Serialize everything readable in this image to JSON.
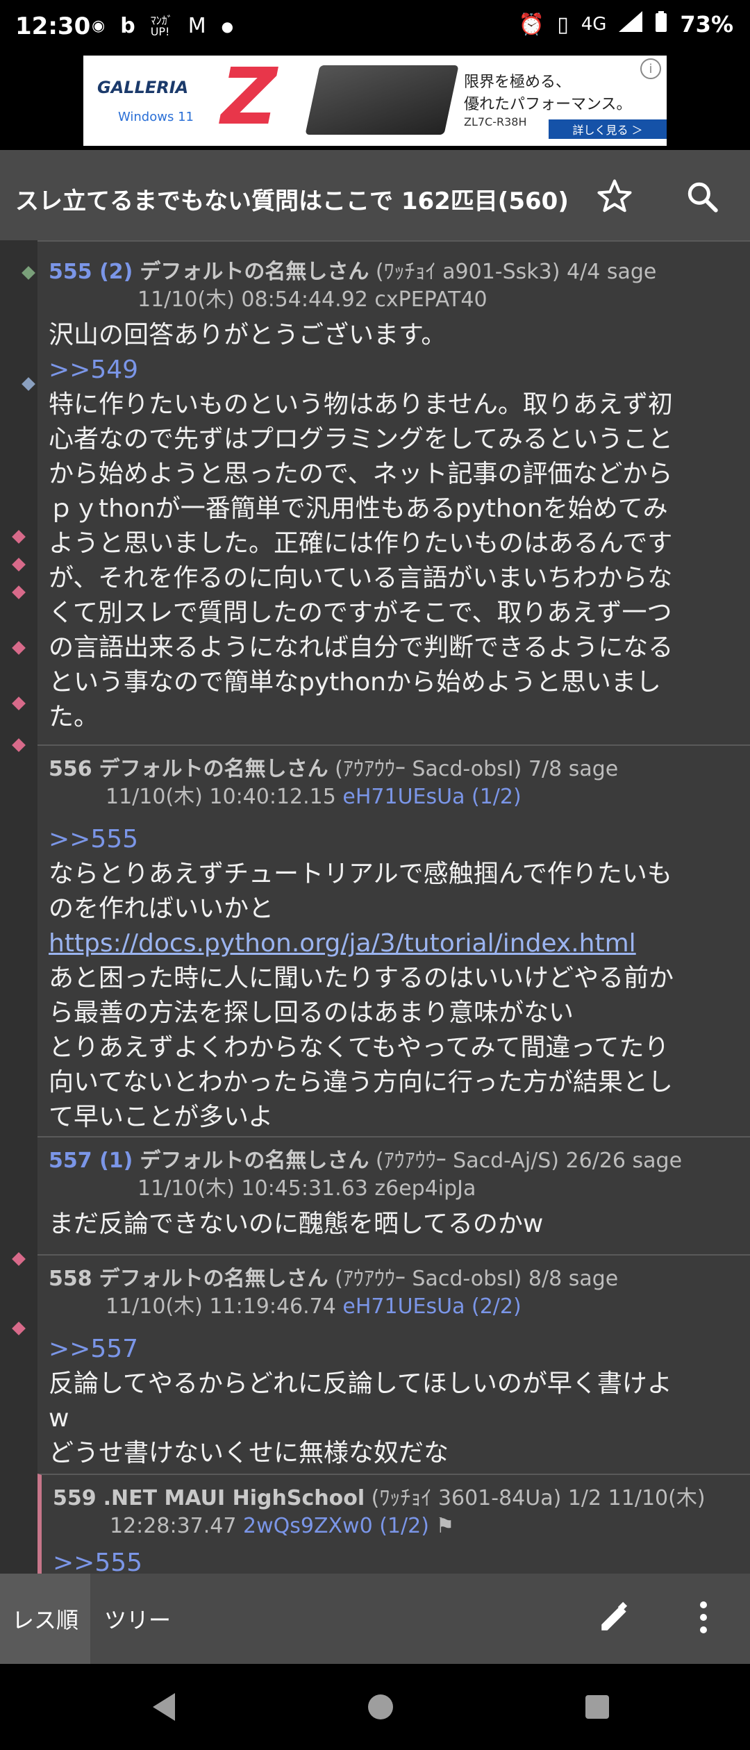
{
  "status": {
    "time": "12:30",
    "network": "4G",
    "battery": "73%",
    "left_icons": [
      "hups-icon",
      "bing-icon",
      "manga-up-icon",
      "gmail-icon",
      "dot-icon"
    ]
  },
  "ad": {
    "brand": "GALLERIA",
    "os": "Windows 11",
    "letter": "Z",
    "line1": "限界を極める、",
    "line2": "優れたパフォーマンス。",
    "model": "ZL7C-R38H",
    "cta": "詳しく見る ＞",
    "info": "i"
  },
  "appbar": {
    "title": "スレ立てるまでもない質問はここで 162匹目(560)"
  },
  "posts": [
    {
      "no": "555 (2)",
      "name": "デフォルトの名無しさん",
      "meta": "(ﾜｯﾁｮｲ a901-Ssk3) 4/4 sage",
      "date": "11/10(木) 08:54:44.92 cxPEPAT40",
      "id_link": "",
      "lines": [
        "沢山の回答ありがとうございます。",
        ">>549",
        "特に作りたいものという物はありません。取りあえず初",
        "心者なので先ずはプログラミングをしてみるということ",
        "から始めようと思ったので、ネット記事の評価などから",
        "ｐｙthonが一番簡単で汎用性もあるpythonを始めてみ",
        "ようと思いました。正確には作りたいものはあるんです",
        "が、それを作るのに向いている言語がいまいちわからな",
        "くて別スレで質問したのですがそこで、取りあえず一つ",
        "の言語出来るようになれば自分で判断できるようになる",
        "という事なので簡単なpythonから始めようと思いまし",
        "た。"
      ]
    },
    {
      "no": "556",
      "name": "デフォルトの名無しさん",
      "meta": "(ｱｳｱｳｳｰ Sacd-obsI) 7/8 sage",
      "date": "11/10(木) 10:40:12.15",
      "id_link": "eH71UEsUa (1/2)",
      "lines": [
        ">>555",
        "ならとりあえずチュートリアルで感触掴んで作りたいも",
        "のを作ればいいかと",
        "https://docs.python.org/ja/3/tutorial/index.html",
        "あと困った時に人に聞いたりするのはいいけどやる前か",
        "ら最善の方法を探し回るのはあまり意味がない",
        "とりあえずよくわからなくてもやってみて間違ってたり",
        "向いてないとわかったら違う方向に行った方が結果とし",
        "て早いことが多いよ"
      ]
    },
    {
      "no": "557 (1)",
      "name": "デフォルトの名無しさん",
      "meta": "(ｱｳｱｳｳｰ Sacd-Aj/S) 26/26 sage",
      "date": "11/10(木) 10:45:31.63 z6ep4ipJa",
      "id_link": "",
      "lines": [
        "まだ反論できないのに醜態を晒してるのかw"
      ]
    },
    {
      "no": "558",
      "name": "デフォルトの名無しさん",
      "meta": "(ｱｳｱｳｳｰ Sacd-obsI) 8/8 sage",
      "date": "11/10(木) 11:19:46.74",
      "id_link": "eH71UEsUa (2/2)",
      "lines": [
        ">>557",
        "反論してやるからどれに反論してほしいのが早く書けよ",
        "w",
        "どうせ書けないくせに無様な奴だな"
      ]
    },
    {
      "no": "559",
      "name": ".NET MAUI HighSchool",
      "meta": "(ﾜｯﾁｮｲ 3601-84Ua) 1/2  11/10(木)",
      "date": "12:28:37.47",
      "id_link": "2wQs9ZXw0 (1/2)",
      "lines": [
        ">>555"
      ]
    }
  ],
  "bottombar": {
    "tab_order": "レス順",
    "tab_tree": "ツリー"
  },
  "colors": {
    "accent_blue": "#7b96e8",
    "highlight_pink": "#c7768a",
    "appbar": "#4a4a4a",
    "content_bg": "#3b3b3b"
  }
}
